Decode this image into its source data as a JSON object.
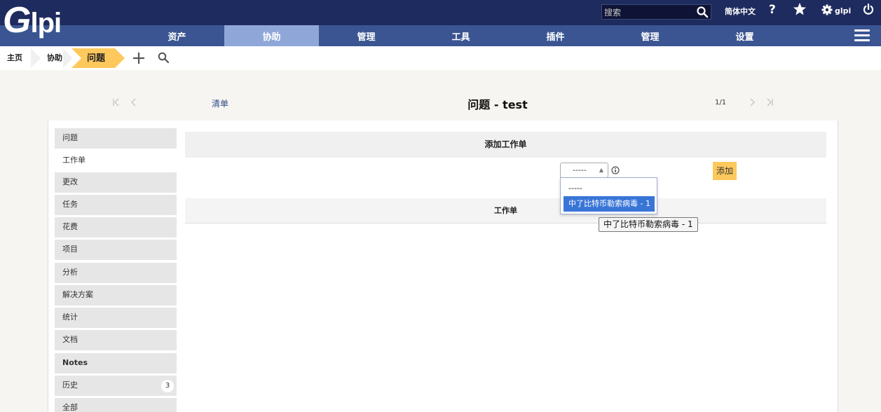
{
  "app": {
    "logo_text": "lpi",
    "logo_g": "G"
  },
  "header": {
    "search_placeholder": "搜索",
    "language": "简体中文",
    "help": "?",
    "user": "glpi"
  },
  "nav": {
    "items": [
      {
        "label": "资产"
      },
      {
        "label": "协助"
      },
      {
        "label": "管理"
      },
      {
        "label": "工具"
      },
      {
        "label": "插件"
      },
      {
        "label": "管理"
      },
      {
        "label": "设置"
      }
    ],
    "active_index": 1
  },
  "breadcrumb": {
    "home": "主页",
    "assistance": "协助",
    "problem": "问题"
  },
  "page": {
    "list_link": "清单",
    "title": "问题 - test",
    "count": "1/1"
  },
  "tabs": [
    {
      "label": "问题"
    },
    {
      "label": "工作单"
    },
    {
      "label": "更改"
    },
    {
      "label": "任务"
    },
    {
      "label": "花费"
    },
    {
      "label": "项目"
    },
    {
      "label": "分析"
    },
    {
      "label": "解决方案"
    },
    {
      "label": "统计"
    },
    {
      "label": "文档"
    },
    {
      "label": "Notes"
    },
    {
      "label": "历史",
      "badge": "3"
    },
    {
      "label": "全部"
    }
  ],
  "form": {
    "section_title": "添加工作单",
    "select_value": "-----",
    "add_button": "添加",
    "list_header": "工作单"
  },
  "dropdown": {
    "options": [
      "-----",
      "中了比特币勒索病毒 - 1"
    ],
    "selected_index": 1
  },
  "tooltip": "中了比特币勒索病毒 - 1",
  "colors": {
    "top": "#1e2b5e",
    "nav": "#3a5592",
    "nav_active": "#8fa7d8",
    "accent": "#fec95c"
  }
}
